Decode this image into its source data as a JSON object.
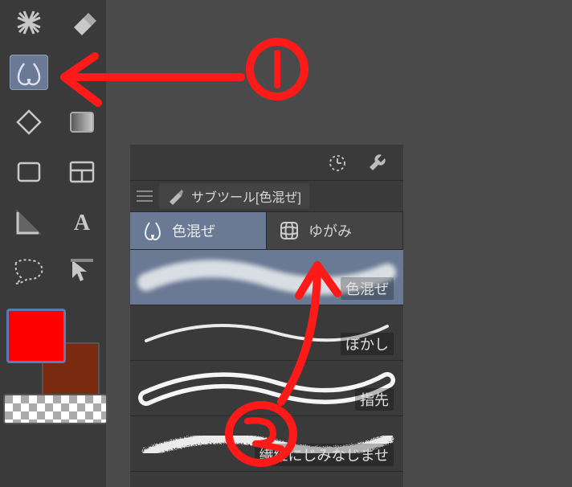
{
  "toolbar": {
    "tools": [
      [
        "marker-x",
        "eraser"
      ],
      [
        "blend",
        null
      ],
      [
        "bucket",
        "gradient"
      ],
      [
        "rect",
        "frame"
      ],
      [
        "ruler",
        "text"
      ],
      [
        "lasso-dash",
        "cursor-arrow"
      ]
    ],
    "selected": "blend",
    "fg_color": "#ff0000",
    "bg_color": "#7a2a10"
  },
  "props_bar": {
    "icon1": "timer",
    "icon2": "wrench"
  },
  "subtool": {
    "title_prefix": "サブツール",
    "title_group": "[色混ぜ]",
    "tabs": [
      {
        "id": "blend",
        "label": "色混ぜ",
        "active": true,
        "icon": "droplets"
      },
      {
        "id": "distort",
        "label": "ゆがみ",
        "active": false,
        "icon": "grid-distort"
      }
    ],
    "items": [
      {
        "label": "色混ぜ",
        "selected": true,
        "stroke": "soft-wave"
      },
      {
        "label": "ぼかし",
        "selected": false,
        "stroke": "thin-wave"
      },
      {
        "label": "指先",
        "selected": false,
        "stroke": "smudge-wave"
      },
      {
        "label": "繊維にじみなじませ",
        "selected": false,
        "stroke": "fiber-wave"
      }
    ]
  },
  "annotation": {
    "mark1": "1",
    "mark2": "2",
    "color": "#ff1a1a"
  }
}
